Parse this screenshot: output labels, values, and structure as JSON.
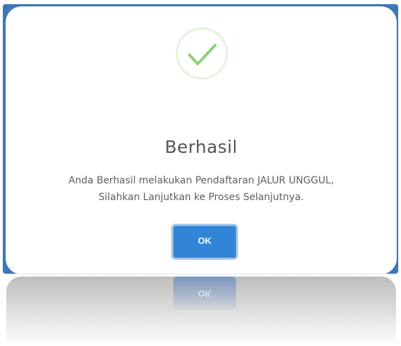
{
  "dialog": {
    "icon": "success-check-icon",
    "title": "Berhasil",
    "message_line1": "Anda Berhasil melakukan Pendaftaran JALUR UNGGUL,",
    "message_line2": "Silahkan Lanjutkan ke Proses Selanjutnya.",
    "ok_label": "OK"
  },
  "colors": {
    "accent": "#3184d6",
    "success": "#8fd07a",
    "title": "#545454",
    "text": "#5e5e5e"
  }
}
